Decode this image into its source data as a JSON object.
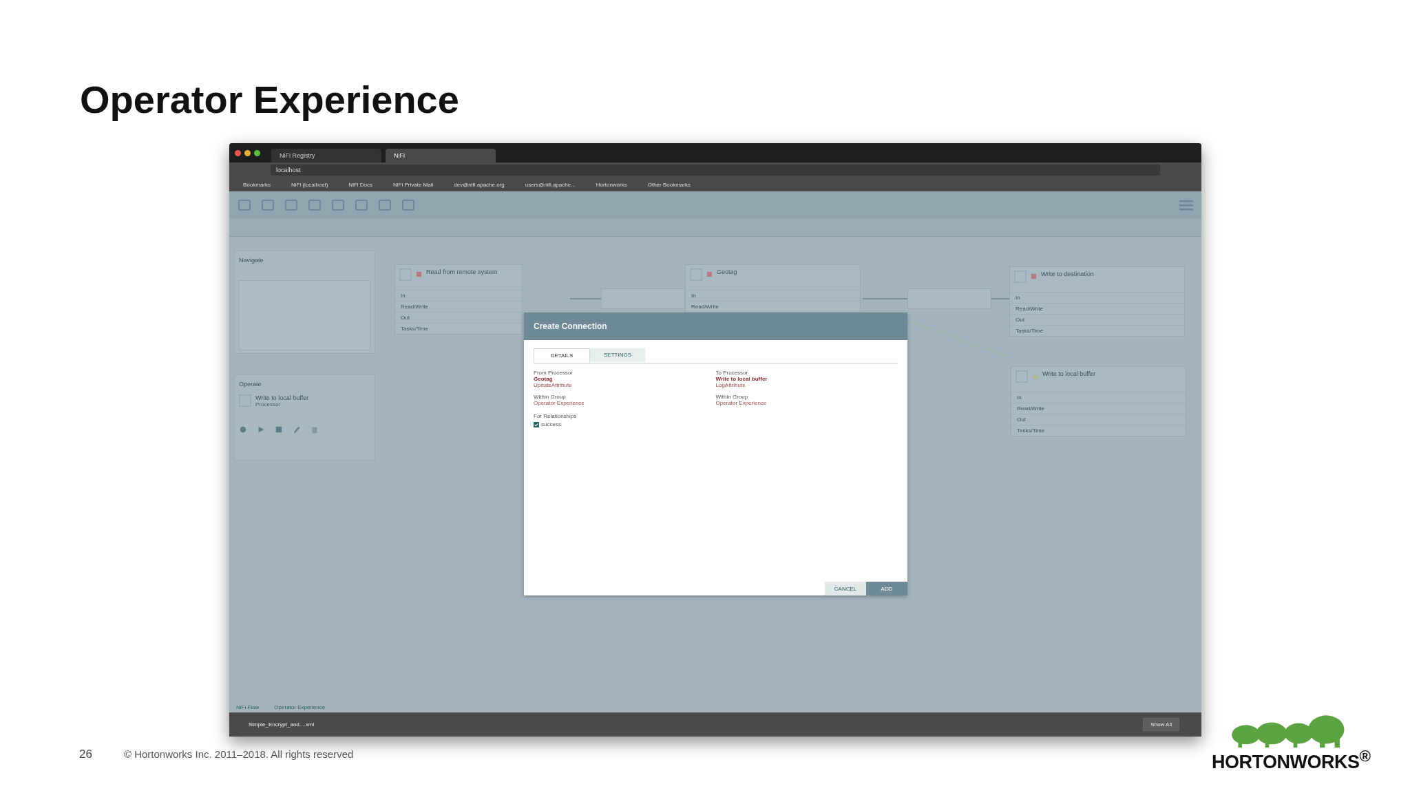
{
  "slide": {
    "title": "Operator Experience",
    "page_number": "26",
    "copyright": "© Hortonworks Inc. 2011–2018. All rights reserved",
    "logo_text": "HORTONWORKS$^{®}$"
  },
  "browser": {
    "tabs": [
      {
        "label": "NiFi Registry",
        "selected": false
      },
      {
        "label": "NiFi",
        "selected": true
      }
    ],
    "address": "localhost",
    "bookmarks": [
      "Bookmarks",
      "NiFi (localhost)",
      "NiFi Docs",
      "NiFi Private Mail",
      "dev@nifi.apache.org",
      "users@nifi.apache...",
      "Hortonworks",
      "Other Bookmarks"
    ]
  },
  "navigate_panel": {
    "title": "Navigate"
  },
  "operate_panel": {
    "title": "Operate",
    "component": "Write to local buffer",
    "component_type": "Processor"
  },
  "processors": [
    {
      "name": "Read from remote system",
      "kind": "stopped",
      "stats": [
        "In",
        "Read/Write",
        "Out",
        "Tasks/Time"
      ]
    },
    {
      "name": "Geotag",
      "kind": "stopped",
      "stats": [
        "In",
        "Read/Write"
      ]
    },
    {
      "name": "Write to destination",
      "kind": "stopped",
      "stats": [
        "In",
        "Read/Write",
        "Out",
        "Tasks/Time"
      ]
    },
    {
      "name": "Write to local buffer",
      "kind": "invalid",
      "stats": [
        "In",
        "Read/Write",
        "Out",
        "Tasks/Time"
      ]
    }
  ],
  "dialog": {
    "title": "Create Connection",
    "tabs": [
      {
        "label": "DETAILS",
        "selected": true
      },
      {
        "label": "SETTINGS",
        "selected": false
      }
    ],
    "from": {
      "label": "From Processor",
      "name": "Geotag",
      "type": "UpdateAttribute",
      "group_label": "Within Group",
      "group": "Operator Experience"
    },
    "to": {
      "label": "To Processor",
      "name": "Write to local buffer",
      "type": "LogAttribute",
      "group_label": "Within Group",
      "group": "Operator Experience"
    },
    "relationships": {
      "label": "For Relationships",
      "items": [
        {
          "name": "success",
          "checked": true
        }
      ]
    },
    "buttons": [
      {
        "label": "CANCEL",
        "kind": "secondary"
      },
      {
        "label": "ADD",
        "kind": "primary"
      }
    ]
  },
  "breadcrumbs": [
    "NiFi Flow",
    "Operator Experience"
  ],
  "downloads": {
    "file": "Simple_Encrypt_and....xml",
    "show_all": "Show All"
  }
}
